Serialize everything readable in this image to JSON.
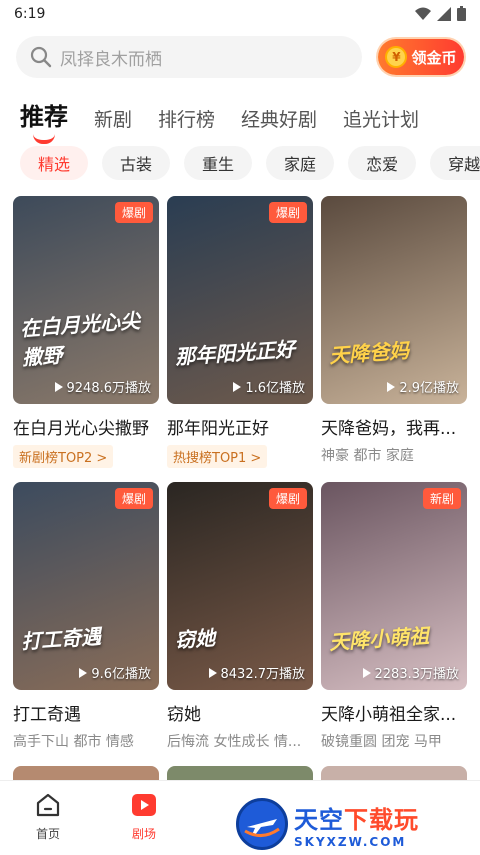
{
  "status": {
    "time": "6:19"
  },
  "search": {
    "placeholder": "凤择良木而栖",
    "coin_label": "领金币",
    "coin_symbol": "¥"
  },
  "tabs": [
    {
      "label": "推荐",
      "active": true
    },
    {
      "label": "新剧",
      "active": false
    },
    {
      "label": "排行榜",
      "active": false
    },
    {
      "label": "经典好剧",
      "active": false
    },
    {
      "label": "追光计划",
      "active": false
    }
  ],
  "chips": [
    {
      "label": "精选",
      "active": true
    },
    {
      "label": "古装",
      "active": false
    },
    {
      "label": "重生",
      "active": false
    },
    {
      "label": "家庭",
      "active": false
    },
    {
      "label": "恋爱",
      "active": false
    },
    {
      "label": "穿越",
      "active": false
    }
  ],
  "cards": [
    {
      "title": "在白月光心尖撒野",
      "badge": "爆剧",
      "plays": "9248.6万播放",
      "art": "在白月光心尖撒野",
      "rank": "新剧榜TOP2 >",
      "tags": "",
      "colors": [
        "#3d4a5a",
        "#8c7a6a"
      ]
    },
    {
      "title": "那年阳光正好",
      "badge": "爆剧",
      "plays": "1.6亿播放",
      "art": "那年阳光正好",
      "rank": "热搜榜TOP1 >",
      "tags": "",
      "colors": [
        "#2a3d52",
        "#6e5a4c"
      ]
    },
    {
      "title": "天降爸妈，我再...",
      "badge": "",
      "plays": "2.9亿播放",
      "art": "天降爸妈",
      "rank": "",
      "tags": "神豪  都市  家庭",
      "colors": [
        "#5a4a3e",
        "#c9b39a"
      ]
    },
    {
      "title": "打工奇遇",
      "badge": "爆剧",
      "plays": "9.6亿播放",
      "art": "打工奇遇",
      "rank": "",
      "tags": "高手下山  都市  情感",
      "colors": [
        "#3c4b5e",
        "#8a6d58"
      ]
    },
    {
      "title": "窃她",
      "badge": "爆剧",
      "plays": "8432.7万播放",
      "art": "窃她",
      "rank": "",
      "tags": "后悔流  女性成长  情...",
      "colors": [
        "#2a2622",
        "#7a5a48"
      ]
    },
    {
      "title": "天降小萌祖全家...",
      "badge": "新剧",
      "plays": "2283.3万播放",
      "art": "天降小萌祖",
      "rank": "",
      "tags": "破镜重圆  团宠  马甲",
      "colors": [
        "#6a5560",
        "#d8c0c4"
      ]
    }
  ],
  "bottom_nav": [
    {
      "label": "首页",
      "icon": "home-icon",
      "active": false
    },
    {
      "label": "剧场",
      "icon": "play-theater-icon",
      "active": true
    }
  ],
  "watermark": {
    "cn_main": "天空",
    "cn_accent": "下载玩",
    "en": "SKYXZW.COM"
  },
  "accent_color": "#ff3b30"
}
